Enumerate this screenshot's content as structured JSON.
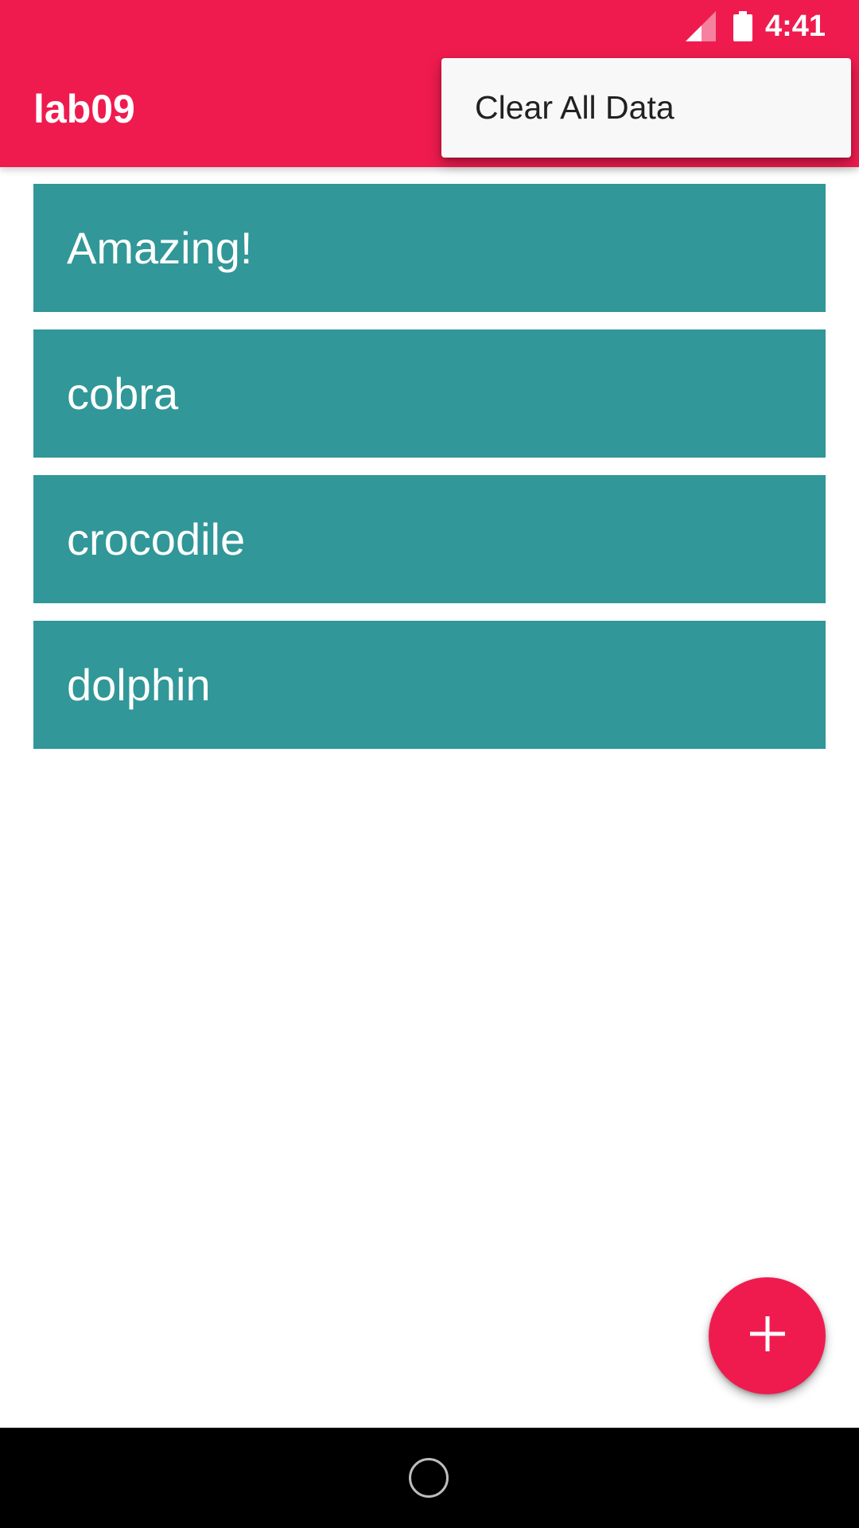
{
  "status_bar": {
    "time": "4:41",
    "signal_icon": "signal-icon",
    "battery_icon": "battery-icon"
  },
  "app_bar": {
    "title": "lab09",
    "color": "#ef1b4f"
  },
  "overflow_menu": {
    "items": [
      {
        "label": "Clear All Data"
      }
    ]
  },
  "list": {
    "item_color": "#319798",
    "items": [
      {
        "label": "Amazing!"
      },
      {
        "label": "cobra"
      },
      {
        "label": "crocodile"
      },
      {
        "label": "dolphin"
      }
    ]
  },
  "fab": {
    "icon": "plus-icon",
    "color": "#ef1b4f"
  },
  "nav_bar": {
    "home_icon": "home-circle-icon"
  }
}
